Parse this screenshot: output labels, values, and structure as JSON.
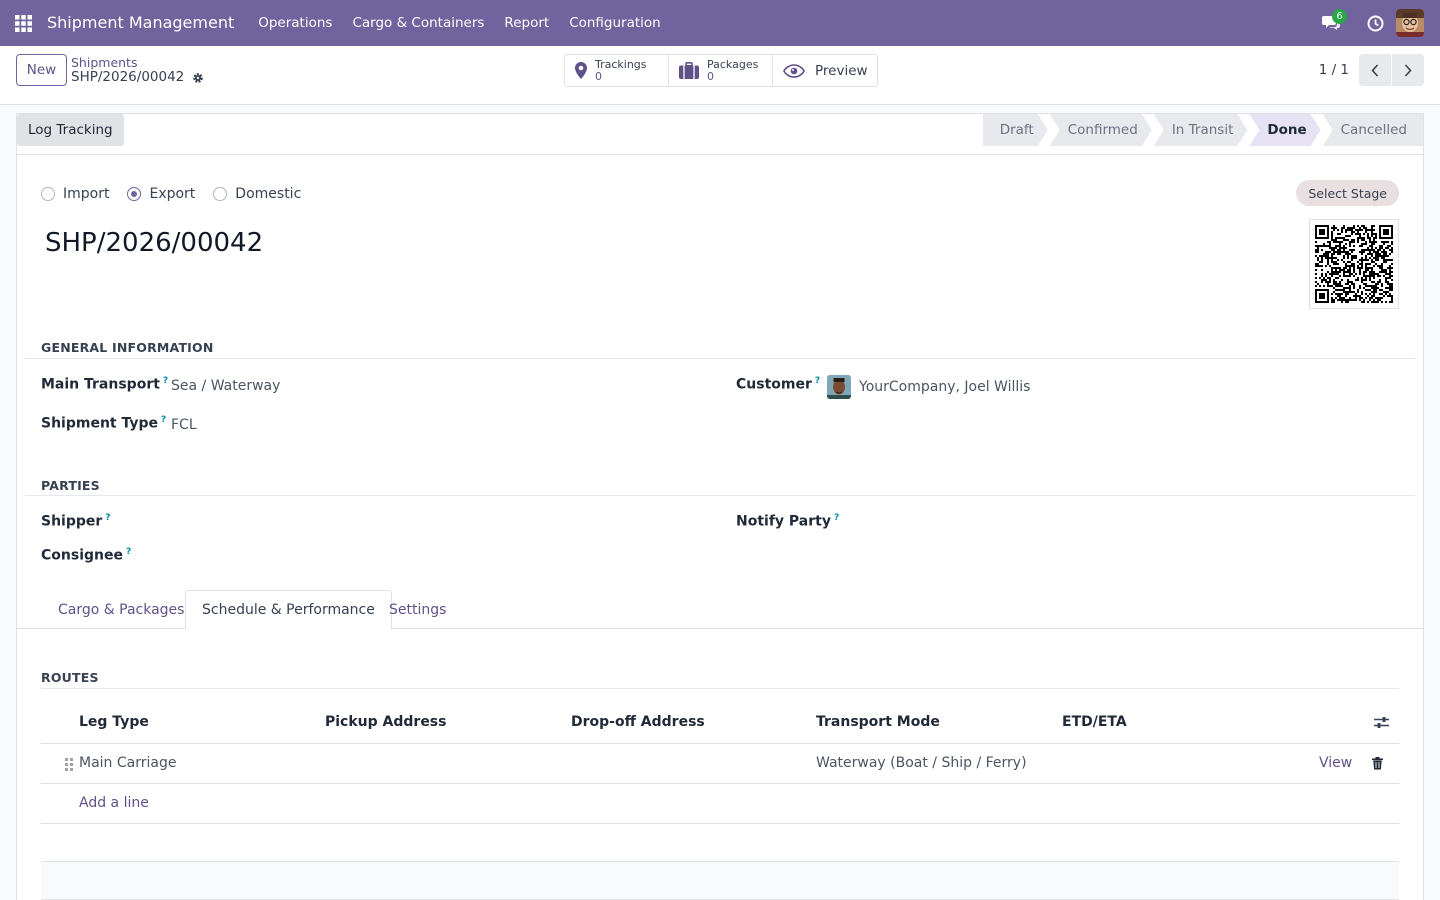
{
  "navbar": {
    "app_title": "Shipment Management",
    "menu": [
      "Operations",
      "Cargo & Containers",
      "Report",
      "Configuration"
    ],
    "messages_count": "6",
    "accent_color": "#71639e"
  },
  "control": {
    "new_label": "New",
    "breadcrumb_parent": "Shipments",
    "breadcrumb_current": "SHP/2026/00042",
    "stats": {
      "trackings_label": "Trackings",
      "trackings_value": "0",
      "packages_label": "Packages",
      "packages_value": "0",
      "preview_label": "Preview"
    },
    "pager": "1 / 1"
  },
  "statusbar": {
    "log_tracking_label": "Log Tracking",
    "stages": [
      "Draft",
      "Confirmed",
      "In Transit",
      "Done",
      "Cancelled"
    ],
    "active_stage": "Done"
  },
  "form": {
    "direction_options": [
      "Import",
      "Export",
      "Domestic"
    ],
    "direction_selected": "Export",
    "title": "SHP/2026/00042",
    "select_stage_label": "Select Stage",
    "general_info": {
      "heading": "GENERAL INFORMATION",
      "main_transport_label": "Main Transport",
      "main_transport_value": "Sea / Waterway",
      "shipment_type_label": "Shipment Type",
      "shipment_type_value": "FCL",
      "customer_label": "Customer",
      "customer_value": "YourCompany, Joel Willis"
    },
    "parties": {
      "heading": "PARTIES",
      "shipper_label": "Shipper",
      "consignee_label": "Consignee",
      "notify_party_label": "Notify Party"
    },
    "help_mark": "?"
  },
  "tabs": {
    "items": [
      "Cargo & Packages",
      "Schedule & Performance",
      "Settings"
    ],
    "active": "Schedule & Performance"
  },
  "routes": {
    "heading": "ROUTES",
    "columns": [
      "Leg Type",
      "Pickup Address",
      "Drop-off Address",
      "Transport Mode",
      "ETD/ETA"
    ],
    "rows": [
      {
        "leg_type": "Main Carriage",
        "pickup": "",
        "dropoff": "",
        "transport_mode": "Waterway (Boat / Ship / Ferry)",
        "etd_eta": "",
        "action": "View"
      }
    ],
    "add_line_label": "Add a line"
  }
}
